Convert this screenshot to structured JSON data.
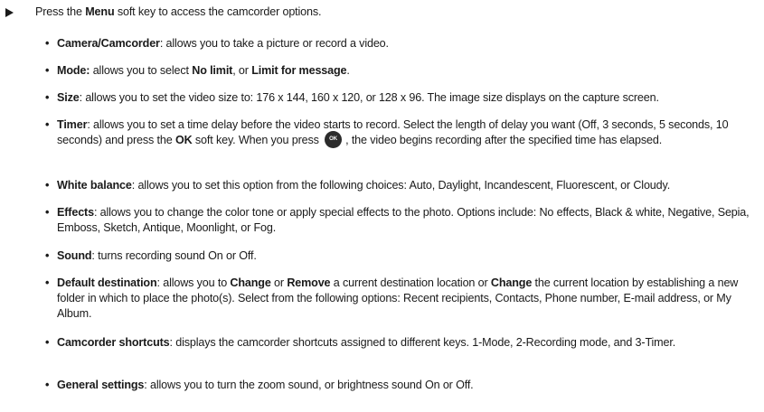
{
  "intro": {
    "pre": "Press the ",
    "key": "Menu",
    "post": " soft key to access the camcorder options."
  },
  "options": [
    {
      "term": "Camera/Camcorder",
      "sep": ": ",
      "desc": "allows you to take a picture or record a video."
    },
    {
      "term": "Mode:",
      "sep": " ",
      "desc1": "allows you to select ",
      "b1": "No limit",
      "desc2": ", or ",
      "b2": "Limit for message",
      "desc3": "."
    },
    {
      "term": "Size",
      "sep": ": ",
      "desc": "allows you to set the video size to: 176 x 144, 160 x 120, or 128 x 96. The image size displays on the capture screen."
    },
    {
      "term": "Timer",
      "sep": ": ",
      "desc1": "allows you to set a time delay before the video starts to record. Select the length of delay you want (Off, 3 seconds, 5 seconds, 10 seconds) and press the ",
      "b1": "OK",
      "desc2": " soft key. When you press ",
      "icon": "ok-key-icon",
      "icon_label": "OK",
      "desc3": ", the video begins recording after the specified time has elapsed."
    },
    {
      "term": "White balance",
      "sep": ": ",
      "desc": "allows you to set this option from the following choices: Auto, Daylight, Incandescent, Fluorescent, or Cloudy."
    },
    {
      "term": "Effects",
      "sep": ": ",
      "desc": "allows you to change the color tone or apply special effects to the photo. Options include: No effects, Black & white, Negative, Sepia, Emboss, Sketch, Antique, Moonlight, or Fog."
    },
    {
      "term": "Sound",
      "sep": ": ",
      "desc": "turns recording sound On or Off."
    },
    {
      "term": "Default destination",
      "sep": ": ",
      "desc1": "allows you to ",
      "b1": "Change",
      "desc2": " or ",
      "b2": "Remove",
      "desc3": " a current destination location or ",
      "b3": "Change",
      "desc4": " the current location by establishing a new folder in which to place the photo(s). Select from the following options: Recent recipients, Contacts, Phone number, E-mail address, or My Album."
    },
    {
      "term": "Camcorder shortcuts",
      "sep": ": ",
      "desc": "displays the camcorder shortcuts assigned to different keys. 1-Mode, 2-Recording mode, and 3-Timer."
    },
    {
      "term": "General settings",
      "sep": ": ",
      "desc": "allows you to turn the zoom sound, or brightness sound On or Off."
    }
  ],
  "bullet": "•"
}
